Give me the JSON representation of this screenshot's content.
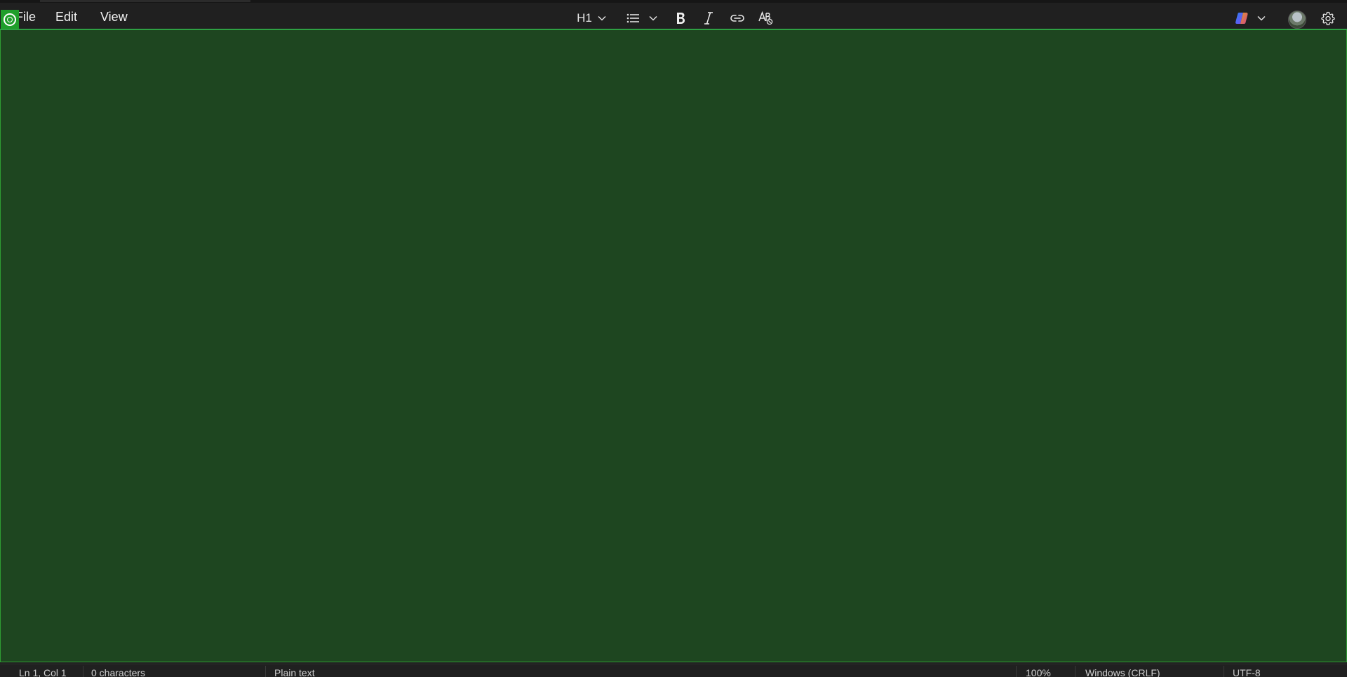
{
  "menu": {
    "file": "File",
    "edit": "Edit",
    "view": "View"
  },
  "toolbar": {
    "heading_value": "H1",
    "icons": {
      "heading_dropdown": "chevron-down-icon",
      "list": "bulleted-list-icon",
      "list_dropdown": "chevron-down-icon",
      "bold": "bold-icon",
      "italic": "italic-icon",
      "link": "link-icon",
      "clear_formatting": "clear-formatting-icon",
      "copilot": "copilot-icon",
      "settings": "gear-icon"
    }
  },
  "editor": {
    "content": "",
    "background_color": "#1e4620",
    "border_color": "#2f9e33"
  },
  "status_bar": {
    "position": "Ln 1, Col 1",
    "characters": "0 characters",
    "format": "Plain text",
    "zoom": "100%",
    "line_ending": "Windows (CRLF)",
    "encoding": "UTF-8"
  },
  "colors": {
    "recording_indicator": "#1f9e2b",
    "chrome_background": "#202020"
  }
}
